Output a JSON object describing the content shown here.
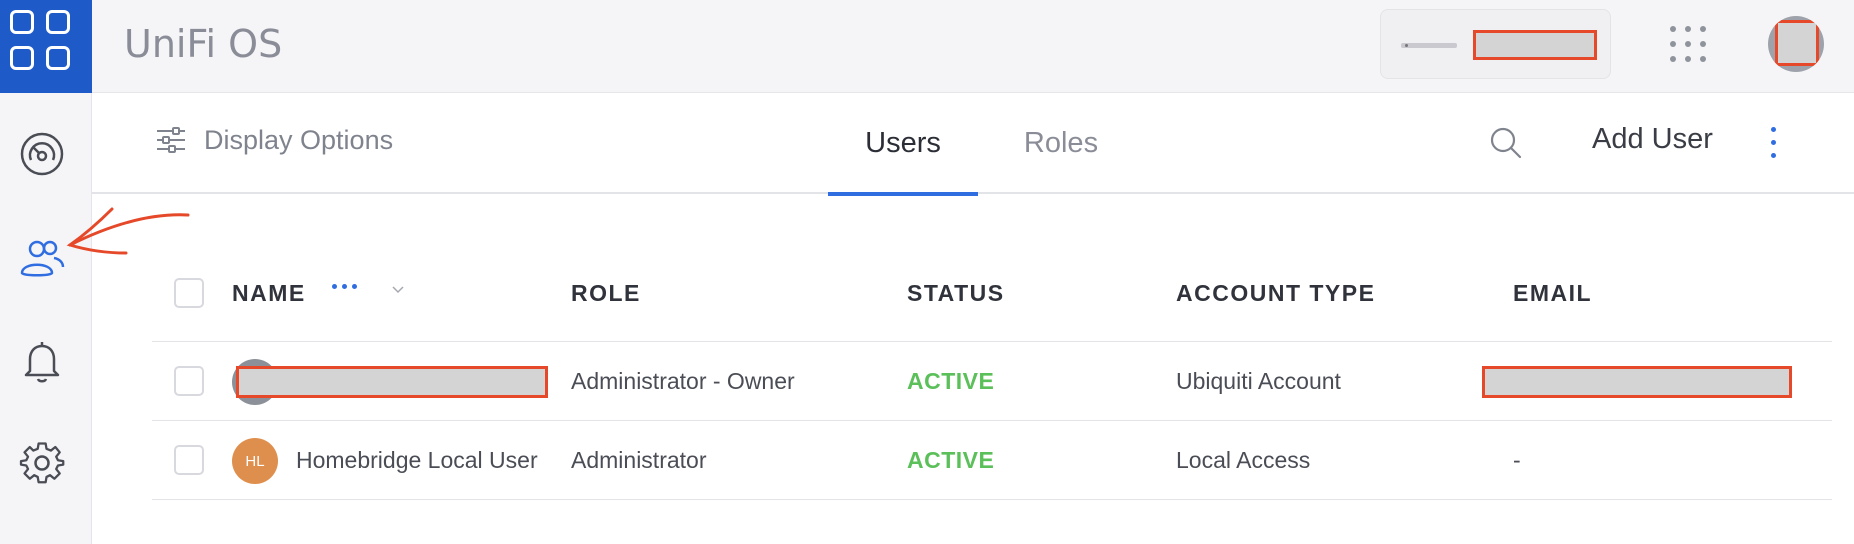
{
  "app": {
    "title": "UniFi OS"
  },
  "topbar": {
    "launcher_icon": "app-grid-icon",
    "device_icon": "console-device-icon",
    "apps_icon": "apps-dots-icon",
    "avatar_icon": "user-avatar"
  },
  "sidebar": {
    "items": [
      {
        "name": "dashboard",
        "icon": "gauge-icon"
      },
      {
        "name": "users",
        "icon": "users-icon",
        "active": true
      },
      {
        "name": "notifications",
        "icon": "bell-icon"
      },
      {
        "name": "settings",
        "icon": "gear-icon"
      }
    ]
  },
  "toolbar": {
    "display_options_label": "Display Options",
    "tabs": [
      {
        "label": "Users",
        "active": true
      },
      {
        "label": "Roles",
        "active": false
      }
    ],
    "add_user_label": "Add User"
  },
  "table": {
    "columns": [
      "NAME",
      "ROLE",
      "STATUS",
      "ACCOUNT TYPE",
      "EMAIL"
    ],
    "rows": [
      {
        "name": "",
        "initials": "",
        "role": "Administrator - Owner",
        "status": "ACTIVE",
        "account_type": "Ubiquiti Account",
        "email": ""
      },
      {
        "name": "Homebridge Local User",
        "initials": "HL",
        "role": "Administrator",
        "status": "ACTIVE",
        "account_type": "Local Access",
        "email": "-"
      }
    ]
  },
  "colors": {
    "accent": "#2f6de1",
    "launcher_bg": "#1e5ac8",
    "status_active": "#5cc05a",
    "avatar_hl": "#df8f4d",
    "annotation": "#e5492a"
  }
}
